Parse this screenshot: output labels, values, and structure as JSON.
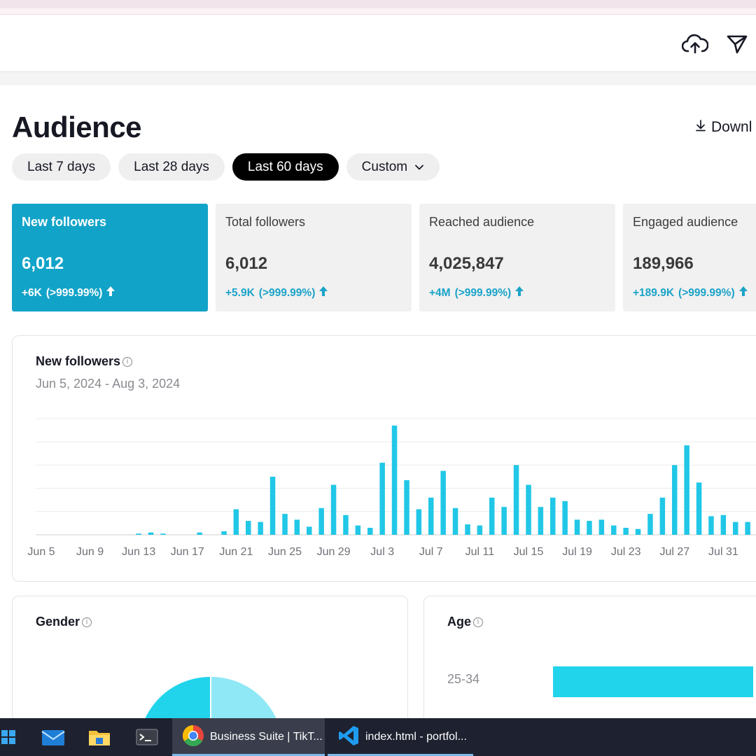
{
  "header": {
    "upload_icon": "cloud-upload-icon",
    "send_icon": "send-icon"
  },
  "page": {
    "title": "Audience",
    "download_label": "Downl",
    "download_icon": "download-arrow-icon"
  },
  "date_filters": [
    {
      "label": "Last 7 days",
      "active": false
    },
    {
      "label": "Last 28 days",
      "active": false
    },
    {
      "label": "Last 60 days",
      "active": true
    },
    {
      "label": "Custom",
      "active": false,
      "dropdown": true
    }
  ],
  "metric_cards": [
    {
      "title": "New followers",
      "value": "6,012",
      "delta": "+6K",
      "percent": "(>999.99%)",
      "active": true
    },
    {
      "title": "Total followers",
      "value": "6,012",
      "delta": "+5.9K",
      "percent": "(>999.99%)",
      "active": false
    },
    {
      "title": "Reached audience",
      "value": "4,025,847",
      "delta": "+4M",
      "percent": "(>999.99%)",
      "active": false
    },
    {
      "title": "Engaged audience",
      "value": "189,966",
      "delta": "+189.9K",
      "percent": "(>999.99%)",
      "active": false
    }
  ],
  "followers_chart": {
    "title": "New followers",
    "date_range": "Jun 5, 2024 - Aug 3, 2024"
  },
  "chart_data": {
    "type": "bar",
    "title": "New followers",
    "x_tick_labels": [
      "Jun 5",
      "Jun 9",
      "Jun 13",
      "Jun 17",
      "Jun 21",
      "Jun 25",
      "Jun 29",
      "Jul 3",
      "Jul 7",
      "Jul 11",
      "Jul 15",
      "Jul 19",
      "Jul 23",
      "Jul 27",
      "Jul 31"
    ],
    "categories": [
      "Jun 5",
      "Jun 6",
      "Jun 7",
      "Jun 8",
      "Jun 9",
      "Jun 10",
      "Jun 11",
      "Jun 12",
      "Jun 13",
      "Jun 14",
      "Jun 15",
      "Jun 16",
      "Jun 17",
      "Jun 18",
      "Jun 19",
      "Jun 20",
      "Jun 21",
      "Jun 22",
      "Jun 23",
      "Jun 24",
      "Jun 25",
      "Jun 26",
      "Jun 27",
      "Jun 28",
      "Jun 29",
      "Jun 30",
      "Jul 1",
      "Jul 2",
      "Jul 3",
      "Jul 4",
      "Jul 5",
      "Jul 6",
      "Jul 7",
      "Jul 8",
      "Jul 9",
      "Jul 10",
      "Jul 11",
      "Jul 12",
      "Jul 13",
      "Jul 14",
      "Jul 15",
      "Jul 16",
      "Jul 17",
      "Jul 18",
      "Jul 19",
      "Jul 20",
      "Jul 21",
      "Jul 22",
      "Jul 23",
      "Jul 24",
      "Jul 25",
      "Jul 26",
      "Jul 27",
      "Jul 28",
      "Jul 29",
      "Jul 30",
      "Jul 31",
      "Aug 1",
      "Aug 2",
      "Aug 3"
    ],
    "values": [
      0,
      0,
      0,
      0,
      0,
      0,
      0,
      0,
      1,
      2,
      1,
      0,
      0,
      2,
      0,
      3,
      22,
      12,
      11,
      50,
      18,
      13,
      7,
      23,
      43,
      17,
      8,
      6,
      62,
      94,
      47,
      22,
      32,
      55,
      23,
      9,
      8,
      32,
      24,
      60,
      43,
      24,
      32,
      29,
      13,
      12,
      13,
      8,
      6,
      5,
      18,
      32,
      60,
      77,
      45,
      16,
      17,
      11,
      11,
      18
    ],
    "ylim": [
      0,
      100
    ],
    "grid": true,
    "color": "#21c7e6"
  },
  "gender": {
    "title": "Gender",
    "colors": [
      "#21d4ec",
      "#8fe8f5"
    ]
  },
  "age": {
    "title": "Age",
    "rows": [
      {
        "label": "25-34"
      }
    ],
    "bar_color": "#21d4ec"
  },
  "taskbar": {
    "apps": [
      {
        "label": "Business Suite | TikT...",
        "icon": "chrome-icon",
        "active": true
      },
      {
        "label": "index.html - portfol...",
        "icon": "vscode-icon",
        "active": false
      }
    ]
  }
}
